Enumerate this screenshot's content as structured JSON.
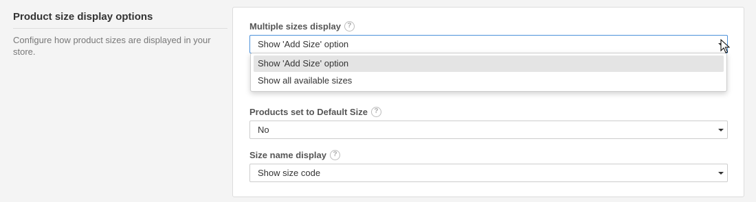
{
  "section": {
    "title": "Product size display options",
    "description": "Configure how product sizes are displayed in your store."
  },
  "fields": {
    "multiple_sizes": {
      "label": "Multiple sizes display",
      "value": "Show 'Add Size' option",
      "options": [
        "Show 'Add Size' option",
        "Show all available sizes"
      ],
      "open": true
    },
    "default_size": {
      "label": "Products set to Default Size",
      "value": "No"
    },
    "size_name": {
      "label": "Size name display",
      "value": "Show size code"
    }
  },
  "icons": {
    "help": "question-mark-circle-icon",
    "caret": "caret-down-icon",
    "cursor": "mouse-pointer-icon"
  },
  "colors": {
    "background": "#f4f4f4",
    "card": "#ffffff",
    "focus_border": "#4a90d9",
    "selected_option": "#e4e4e4"
  }
}
